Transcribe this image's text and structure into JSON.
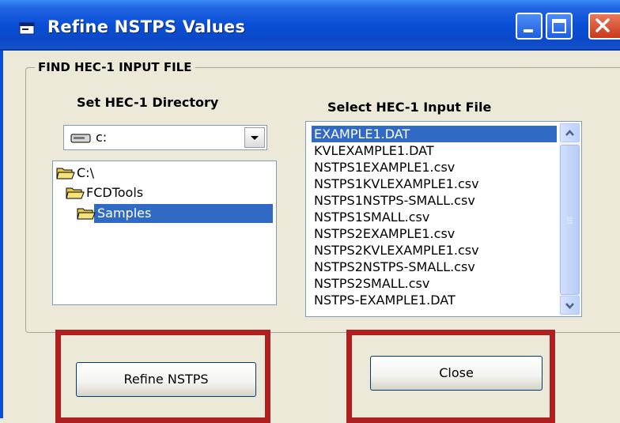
{
  "window": {
    "title": "Refine NSTPS Values",
    "icon": "window-app-icon",
    "controls": [
      "minimize-icon",
      "maximize-icon",
      "close-icon"
    ]
  },
  "group": {
    "label": "FIND HEC-1 INPUT FILE"
  },
  "directory": {
    "label": "Set HEC-1 Directory",
    "drive_value": "c:",
    "drive_icon": "drive-icon",
    "folders": [
      {
        "name": "C:\\",
        "icon": "open-folder-icon"
      },
      {
        "name": "FCDTools",
        "icon": "open-folder-icon"
      },
      {
        "name": "Samples",
        "icon": "open-folder-icon",
        "selected": true
      }
    ]
  },
  "files": {
    "label": "Select HEC-1 Input File",
    "items": [
      "EXAMPLE1.DAT",
      "KVLEXAMPLE1.DAT",
      "NSTPS1EXAMPLE1.csv",
      "NSTPS1KVLEXAMPLE1.csv",
      "NSTPS1NSTPS-SMALL.csv",
      "NSTPS1SMALL.csv",
      "NSTPS2EXAMPLE1.csv",
      "NSTPS2KVLEXAMPLE1.csv",
      "NSTPS2NSTPS-SMALL.csv",
      "NSTPS2SMALL.csv",
      "NSTPS-EXAMPLE1.DAT"
    ],
    "selected_index": 0
  },
  "buttons": {
    "refine_label": "Refine NSTPS",
    "close_label": "Close"
  },
  "colors": {
    "highlight_box": "#b01f1f",
    "selection": "#316ac5",
    "titlebar": "#0a4fd6"
  }
}
